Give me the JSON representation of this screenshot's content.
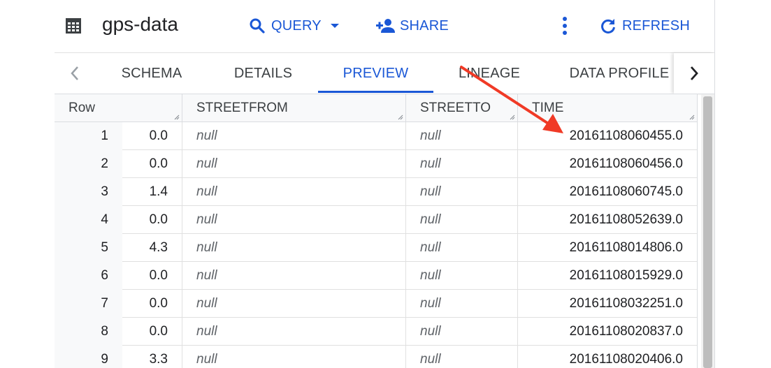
{
  "header": {
    "title": "gps-data",
    "table_icon": "table-icon",
    "query_label": "QUERY",
    "share_label": "SHARE",
    "refresh_label": "REFRESH"
  },
  "tabs": [
    {
      "label": "SCHEMA",
      "active": false
    },
    {
      "label": "DETAILS",
      "active": false
    },
    {
      "label": "PREVIEW",
      "active": true
    },
    {
      "label": "LINEAGE",
      "active": false
    },
    {
      "label": "DATA PROFILE",
      "active": false
    }
  ],
  "table": {
    "row_header": "Row",
    "columns": [
      "",
      "STREETFROM",
      "STREETTO",
      "TIME"
    ],
    "rows": [
      {
        "row": "1",
        "c0": "0.0",
        "streetfrom": "null",
        "streetto": "null",
        "time": "20161108060455.0"
      },
      {
        "row": "2",
        "c0": "0.0",
        "streetfrom": "null",
        "streetto": "null",
        "time": "20161108060456.0"
      },
      {
        "row": "3",
        "c0": "1.4",
        "streetfrom": "null",
        "streetto": "null",
        "time": "20161108060745.0"
      },
      {
        "row": "4",
        "c0": "0.0",
        "streetfrom": "null",
        "streetto": "null",
        "time": "20161108052639.0"
      },
      {
        "row": "5",
        "c0": "4.3",
        "streetfrom": "null",
        "streetto": "null",
        "time": "20161108014806.0"
      },
      {
        "row": "6",
        "c0": "0.0",
        "streetfrom": "null",
        "streetto": "null",
        "time": "20161108015929.0"
      },
      {
        "row": "7",
        "c0": "0.0",
        "streetfrom": "null",
        "streetto": "null",
        "time": "20161108032251.0"
      },
      {
        "row": "8",
        "c0": "0.0",
        "streetfrom": "null",
        "streetto": "null",
        "time": "20161108020837.0"
      },
      {
        "row": "9",
        "c0": "3.3",
        "streetfrom": "null",
        "streetto": "null",
        "time": "20161108020406.0"
      }
    ]
  },
  "colors": {
    "accent": "#1a57d6",
    "annotation_arrow": "#f03a26"
  }
}
